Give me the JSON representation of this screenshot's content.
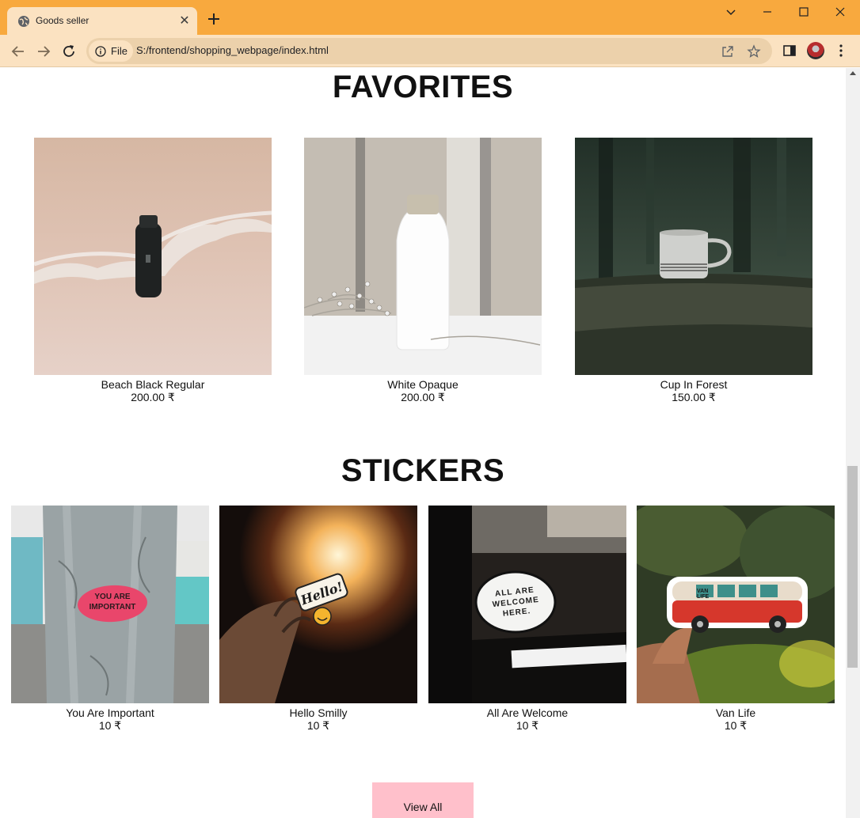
{
  "browser": {
    "tab_title": "Goods seller",
    "chip_label": "File",
    "url": "S:/frontend/shopping_webpage/index.html"
  },
  "colors": {
    "titlebar": "#f8a93e",
    "toolbar": "#fbe2c1",
    "view_all_button": "#ffc0cb"
  },
  "favorites": {
    "title": "FAVORITES",
    "items": [
      {
        "name": "Beach Black Regular",
        "price": "200.00 ₹"
      },
      {
        "name": "White Opaque",
        "price": "200.00 ₹"
      },
      {
        "name": "Cup In Forest",
        "price": "150.00 ₹"
      }
    ]
  },
  "stickers": {
    "title": "STICKERS",
    "items": [
      {
        "name": "You Are Important",
        "price": "10 ₹",
        "sticker_text": "YOU ARE IMPORTANT"
      },
      {
        "name": "Hello Smilly",
        "price": "10 ₹",
        "sticker_text": "Hello!"
      },
      {
        "name": "All Are Welcome",
        "price": "10 ₹",
        "sticker_text": "ALL ARE WELCOME HERE."
      },
      {
        "name": "Van Life",
        "price": "10 ₹",
        "sticker_text": "VAN LIFE"
      }
    ]
  },
  "view_all": {
    "label": "View All"
  }
}
